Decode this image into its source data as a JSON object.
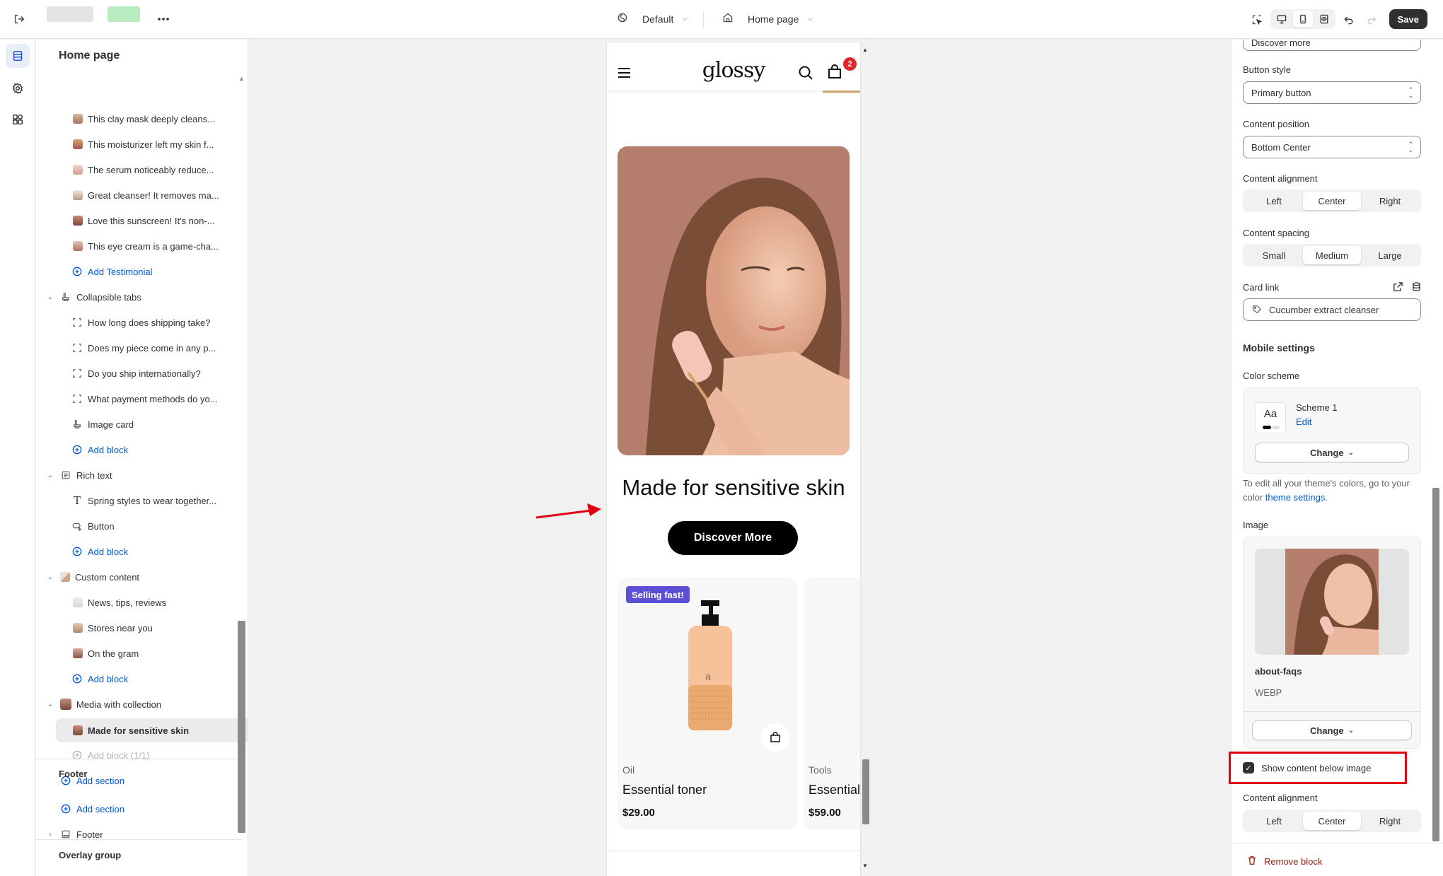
{
  "topbar": {
    "theme_label": "Default",
    "page_label": "Home page",
    "save_label": "Save",
    "icons": [
      "exit-icon",
      "more-icon",
      "theme-icon",
      "home-icon",
      "inspect-icon",
      "desktop-icon",
      "mobile-icon",
      "fullwidth-icon",
      "undo-icon",
      "redo-icon"
    ]
  },
  "sidebar": {
    "title": "Home page",
    "testimonials": [
      "This clay mask deeply cleans...",
      "This moisturizer left my skin f...",
      "The serum noticeably reduce...",
      "Great cleanser! It removes ma...",
      "Love this sunscreen! It's non-...",
      "This eye cream is a game-cha..."
    ],
    "add_testimonial": "Add Testimonial",
    "collapsible_tabs": {
      "label": "Collapsible tabs",
      "items": [
        "How long does shipping take?",
        "Does my piece come in any p...",
        "Do you ship internationally?",
        "What payment methods do yo...",
        "Image card"
      ],
      "add": "Add block"
    },
    "rich_text": {
      "label": "Rich text",
      "items": [
        "Spring styles to wear together...",
        "Button"
      ],
      "add": "Add block"
    },
    "custom_content": {
      "label": "Custom content",
      "items": [
        "News, tips, reviews",
        "Stores near you",
        "On the gram"
      ],
      "add": "Add block"
    },
    "media_collection": {
      "label": "Media with collection",
      "selected": "Made for sensitive skin",
      "add_disabled": "Add block (1/1)"
    },
    "add_section": "Add section",
    "footer": {
      "heading": "Footer",
      "add_section": "Add section",
      "item": "Footer"
    },
    "overlay_group": "Overlay group"
  },
  "preview": {
    "logo": "glossy",
    "cart_count": "2",
    "hero_title": "Made for sensitive skin",
    "hero_button": "Discover More",
    "products": [
      {
        "badge": "Selling fast!",
        "category": "Oil",
        "name": "Essential toner",
        "price": "$29.00"
      },
      {
        "badge": "",
        "category": "Tools",
        "name": "Essential",
        "price": "$59.00"
      }
    ]
  },
  "settings": {
    "top_cut_value": "Discover more",
    "button_style": {
      "label": "Button style",
      "value": "Primary button"
    },
    "content_position": {
      "label": "Content position",
      "value": "Bottom Center"
    },
    "content_alignment": {
      "label": "Content alignment",
      "options": [
        "Left",
        "Center",
        "Right"
      ],
      "selected": "Center"
    },
    "content_spacing": {
      "label": "Content spacing",
      "options": [
        "Small",
        "Medium",
        "Large"
      ],
      "selected": "Medium"
    },
    "card_link": {
      "label": "Card link",
      "value": "Cucumber extract cleanser"
    },
    "mobile_settings": "Mobile settings",
    "color_scheme": {
      "label": "Color scheme",
      "aa": "Aa",
      "name": "Scheme 1",
      "edit": "Edit",
      "change": "Change"
    },
    "help_text_1": "To edit all your theme's colors, go to your color ",
    "help_link": "theme settings",
    "help_text_2": ".",
    "image": {
      "label": "Image",
      "filename": "about-faqs",
      "format": "WEBP",
      "change": "Change"
    },
    "show_below": {
      "label": "Show content below image",
      "checked": true
    },
    "mobile_alignment": {
      "label": "Content alignment",
      "options": [
        "Left",
        "Center",
        "Right"
      ],
      "selected": "Center"
    },
    "remove": "Remove block"
  },
  "colors": {
    "accent_blue": "#005bd3",
    "highlight_red": "#e1000f",
    "badge_purple": "#5b4fd6",
    "cart_badge_red": "#e0262b"
  }
}
